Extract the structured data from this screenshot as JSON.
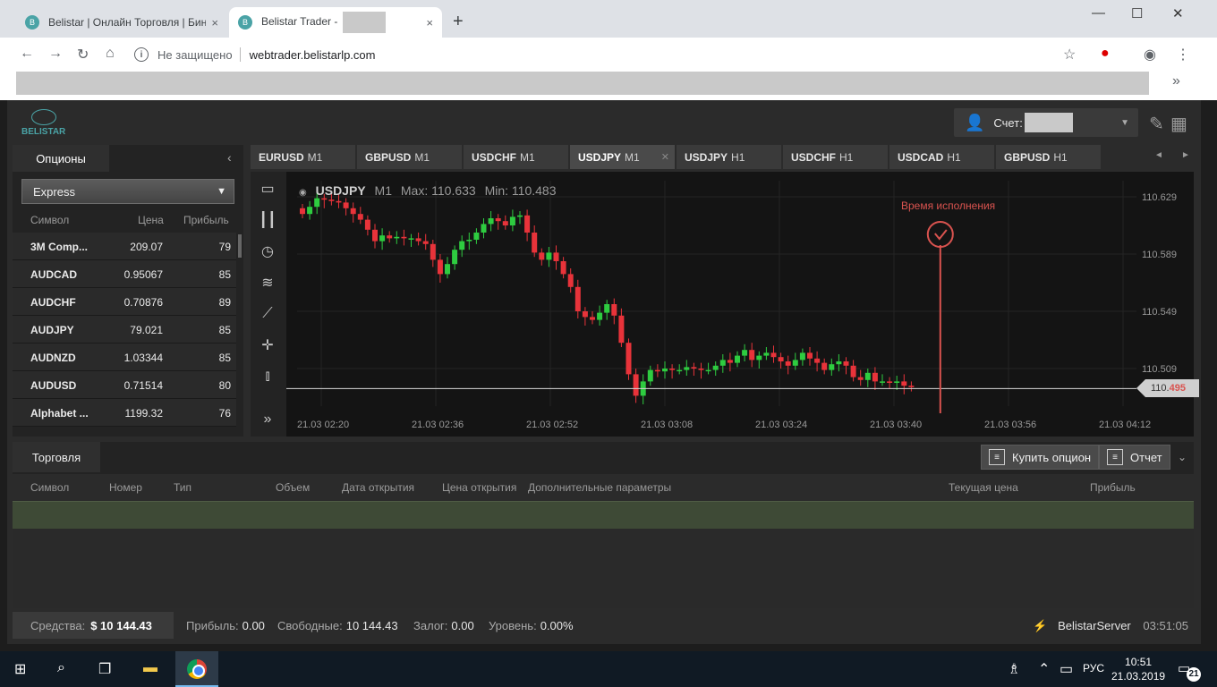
{
  "browser": {
    "tabs": [
      {
        "title": "Belistar | Онлайн Торговля | Бин",
        "close": "×"
      },
      {
        "title": "Belistar Trader - ",
        "close": "×"
      }
    ],
    "new_tab": "+",
    "controls": {
      "minimize": "—",
      "maximize": "☐",
      "close": "✕"
    },
    "security_label": "Не защищено",
    "url": "webtrader.belistarlp.com",
    "bookmarks_more": "»"
  },
  "app": {
    "logo_text": "BELISTAR",
    "account_label": "Счет:",
    "left_panel": {
      "tab": "Опционы",
      "mode": "Express",
      "columns": [
        "Символ",
        "Цена",
        "Прибыль"
      ],
      "rows": [
        {
          "symbol": "3M Comp...",
          "price": "209.07",
          "profit": "79"
        },
        {
          "symbol": "AUDCAD",
          "price": "0.95067",
          "profit": "85"
        },
        {
          "symbol": "AUDCHF",
          "price": "0.70876",
          "profit": "89"
        },
        {
          "symbol": "AUDJPY",
          "price": "79.021",
          "profit": "85"
        },
        {
          "symbol": "AUDNZD",
          "price": "1.03344",
          "profit": "85"
        },
        {
          "symbol": "AUDUSD",
          "price": "0.71514",
          "profit": "80"
        },
        {
          "symbol": "Alphabet ...",
          "price": "1199.32",
          "profit": "76"
        }
      ]
    },
    "chart_tabs": [
      {
        "symbol": "EURUSD",
        "tf": "M1"
      },
      {
        "symbol": "GBPUSD",
        "tf": "M1"
      },
      {
        "symbol": "USDCHF",
        "tf": "M1"
      },
      {
        "symbol": "USDJPY",
        "tf": "M1",
        "active": true
      },
      {
        "symbol": "USDJPY",
        "tf": "H1"
      },
      {
        "symbol": "USDCHF",
        "tf": "H1"
      },
      {
        "symbol": "USDCAD",
        "tf": "H1"
      },
      {
        "symbol": "GBPUSD",
        "tf": "H1"
      }
    ],
    "chart_header": {
      "symbol": "USDJPY",
      "tf": "M1",
      "max": "Max: 110.633",
      "min": "Min: 110.483"
    },
    "execution_label": "Время исполнения",
    "current_price": {
      "base": "110.",
      "highlight": "495"
    },
    "tools_more": "»",
    "bottom": {
      "tab": "Торговля",
      "buy_button": "Купить опцион",
      "report_button": "Отчет",
      "columns": [
        "Символ",
        "Номер",
        "Тип",
        "Объем",
        "Дата открытия",
        "Цена открытия",
        "Дополнительные параметры",
        "Текущая цена",
        "Прибыль"
      ]
    },
    "status": {
      "funds_label": "Средства:",
      "funds_value": "$ 10 144.43",
      "profit_label": "Прибыль:",
      "profit_value": "0.00",
      "free_label": "Свободные:",
      "free_value": "10 144.43",
      "margin_label": "Залог:",
      "margin_value": "0.00",
      "level_label": "Уровень:",
      "level_value": "0.00%",
      "server": "BelistarServer",
      "time": "03:51:05"
    }
  },
  "chart_data": {
    "type": "candlestick",
    "symbol": "USDJPY",
    "timeframe": "M1",
    "y_ticks": [
      110.629,
      110.589,
      110.549,
      110.509
    ],
    "x_ticks": [
      "21.03 02:20",
      "21.03 02:36",
      "21.03 02:52",
      "21.03 03:08",
      "21.03 03:24",
      "21.03 03:40",
      "21.03 03:56",
      "21.03 04:12"
    ],
    "current_price": 110.495,
    "max": 110.633,
    "min": 110.483,
    "up_color": "#2ecc40",
    "down_color": "#e8333a",
    "closes": [
      110.617,
      110.622,
      110.628,
      110.627,
      110.626,
      110.625,
      110.621,
      110.617,
      110.613,
      110.606,
      110.598,
      110.602,
      110.6,
      110.601,
      110.6,
      110.6,
      110.598,
      110.596,
      110.585,
      110.575,
      110.582,
      110.592,
      110.598,
      110.599,
      110.604,
      110.61,
      110.614,
      110.612,
      110.609,
      110.615,
      110.616,
      110.604,
      110.59,
      110.585,
      110.59,
      110.584,
      110.575,
      110.566,
      110.549,
      110.545,
      110.543,
      110.548,
      110.554,
      110.546,
      110.527,
      110.505,
      110.49,
      110.5,
      110.508,
      110.507,
      110.509,
      110.508,
      110.508,
      110.51,
      110.509,
      110.508,
      110.508,
      110.511,
      110.515,
      110.513,
      110.518,
      110.522,
      110.515,
      110.518,
      110.52,
      110.517,
      110.514,
      110.511,
      110.515,
      110.52,
      110.516,
      110.513,
      110.508,
      110.512,
      110.514,
      110.511,
      110.503,
      110.501,
      110.506,
      110.5,
      110.5,
      110.499,
      110.5,
      110.497,
      110.496
    ],
    "execution_marker_index": 88
  },
  "taskbar": {
    "lang": "РУС",
    "time": "10:51",
    "date": "21.03.2019",
    "notifications": "21"
  }
}
